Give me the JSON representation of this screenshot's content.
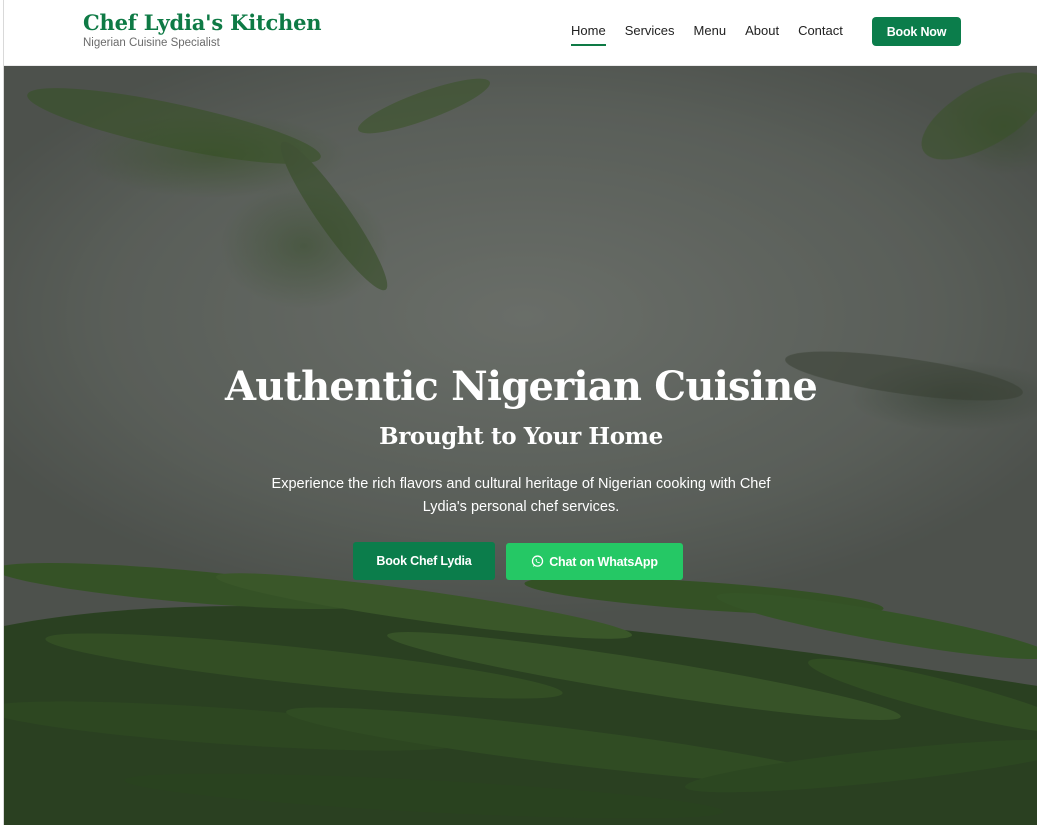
{
  "brand": {
    "title": "Chef Lydia's Kitchen",
    "subtitle": "Nigerian Cuisine Specialist",
    "color": "#0e7a45"
  },
  "nav": {
    "items": [
      {
        "label": "Home",
        "active": true
      },
      {
        "label": "Services",
        "active": false
      },
      {
        "label": "Menu",
        "active": false
      },
      {
        "label": "About",
        "active": false
      },
      {
        "label": "Contact",
        "active": false
      }
    ],
    "cta_label": "Book Now"
  },
  "hero": {
    "title": "Authentic Nigerian Cuisine",
    "subtitle": "Brought to Your Home",
    "description": "Experience the rich flavors and cultural heritage of Nigerian cooking with Chef Lydia's personal chef services.",
    "primary_button": "Book Chef Lydia",
    "whatsapp_button": "Chat on WhatsApp",
    "background_image": "rosemary-sprigs"
  },
  "colors": {
    "primary": "#0b7d4b",
    "whatsapp": "#25c865"
  }
}
